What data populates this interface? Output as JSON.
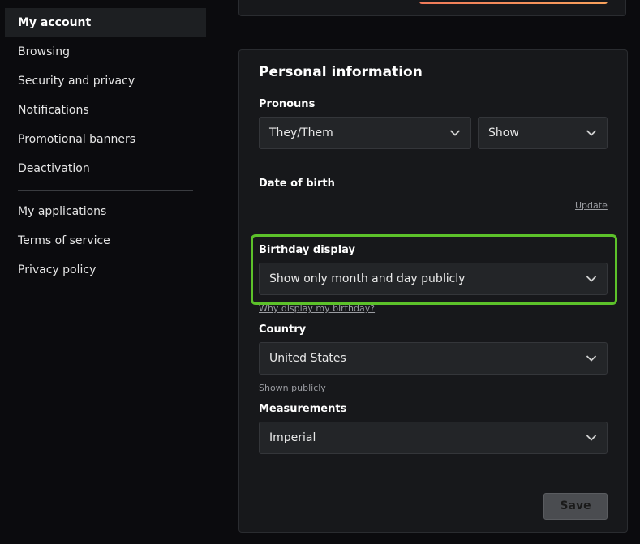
{
  "sidebar": {
    "items": [
      {
        "label": "My account",
        "active": true
      },
      {
        "label": "Browsing"
      },
      {
        "label": "Security and privacy"
      },
      {
        "label": "Notifications"
      },
      {
        "label": "Promotional banners"
      },
      {
        "label": "Deactivation"
      }
    ],
    "secondary_items": [
      {
        "label": "My applications"
      },
      {
        "label": "Terms of service"
      },
      {
        "label": "Privacy policy"
      }
    ]
  },
  "personal_info": {
    "title": "Personal information",
    "pronouns": {
      "label": "Pronouns",
      "value": "They/Them",
      "visibility": "Show"
    },
    "date_of_birth": {
      "label": "Date of birth",
      "update_link": "Update"
    },
    "birthday_display": {
      "label": "Birthday display",
      "value": "Show only month and day publicly",
      "help_link": "Why display my birthday?"
    },
    "country": {
      "label": "Country",
      "value": "United States",
      "hint": "Shown publicly"
    },
    "measurements": {
      "label": "Measurements",
      "value": "Imperial"
    },
    "save_label": "Save"
  },
  "colors": {
    "highlight": "#5cc12a",
    "accent_gradient_start": "#f07a5a",
    "accent_gradient_end": "#f8a15c"
  }
}
